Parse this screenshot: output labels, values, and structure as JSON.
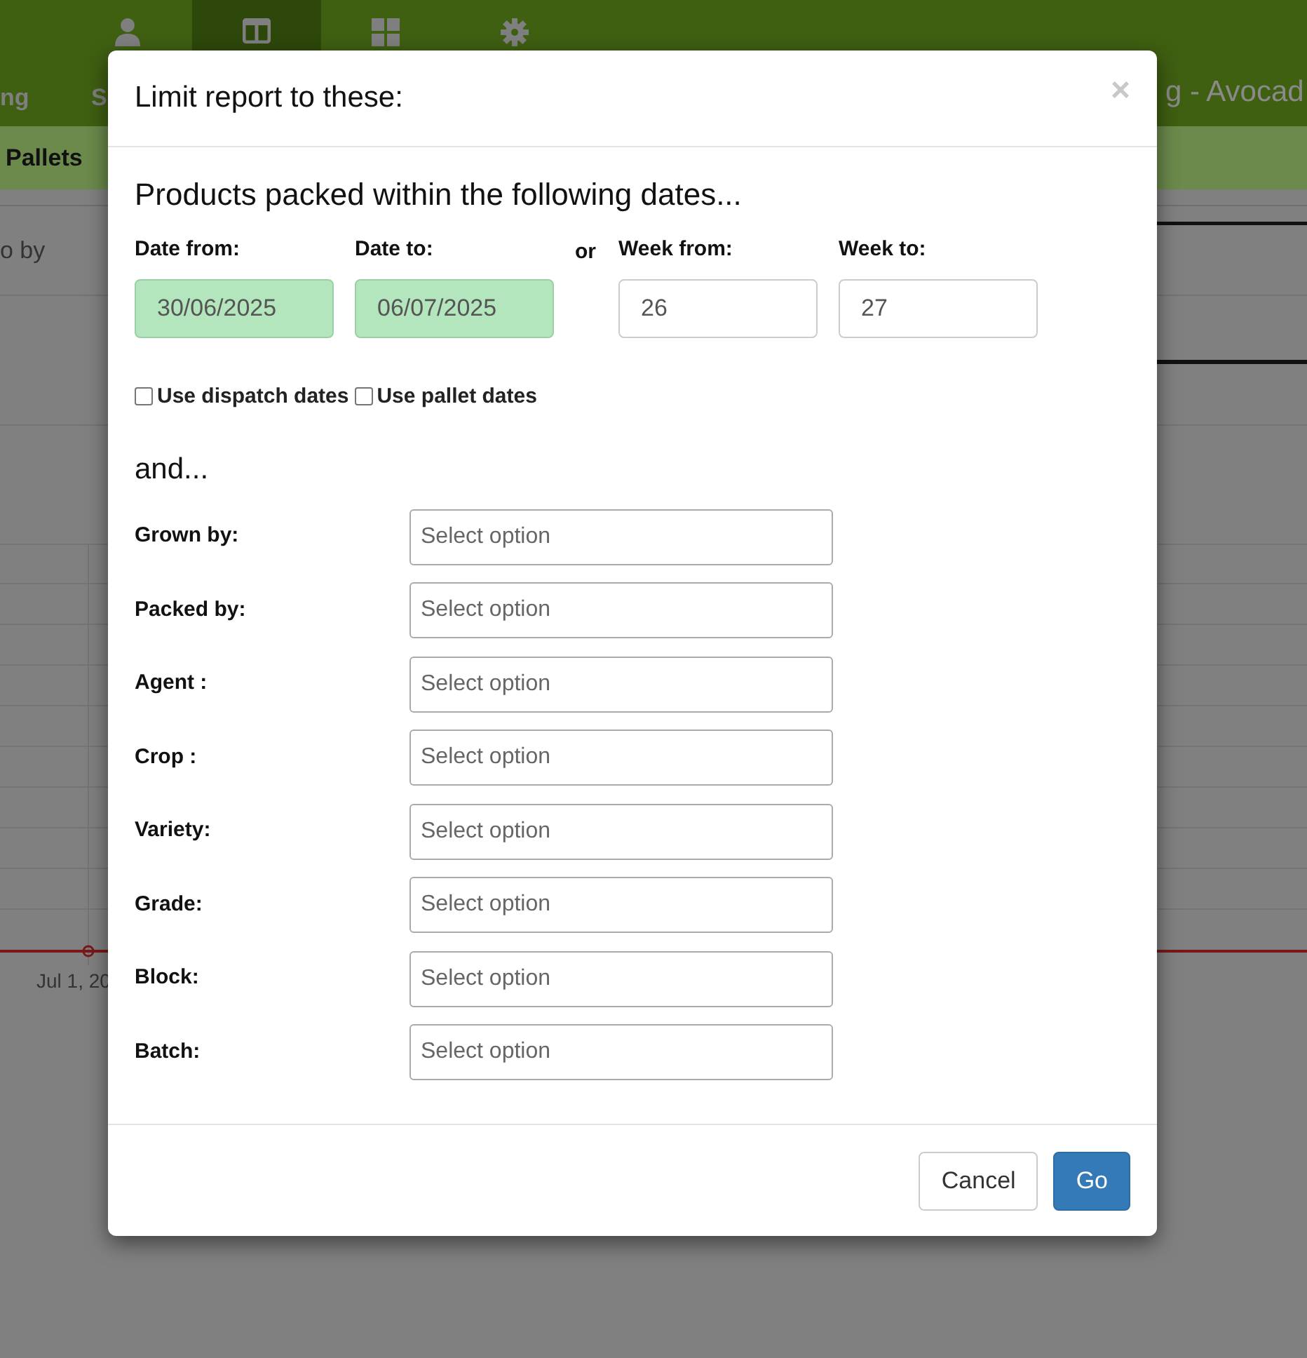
{
  "background": {
    "nav_items": [
      {
        "label": "ng",
        "selected": false
      },
      {
        "label": "S",
        "selected": false
      },
      {
        "selected": true
      },
      {
        "selected": false
      },
      {
        "selected": false
      }
    ],
    "app_title": "g - Avocad",
    "subnav": "Pallets",
    "group_label": "o by",
    "chart_label": "Jul 1, 20"
  },
  "modal": {
    "title": "Limit report to these:",
    "close": "×",
    "dates_heading": "Products packed within the following dates...",
    "date_fields": [
      {
        "label": "Date from:",
        "value": "30/06/2025",
        "highlighted": true
      },
      {
        "label": "Date to:",
        "value": "06/07/2025",
        "highlighted": true
      },
      {
        "label": "Week from:",
        "value": "26",
        "highlighted": false
      },
      {
        "label": "Week to:",
        "value": "27",
        "highlighted": false
      }
    ],
    "separator": "or",
    "checkboxes": [
      {
        "label": "Use dispatch dates",
        "checked": false
      },
      {
        "label": "Use pallet dates",
        "checked": false
      }
    ],
    "filters_heading": "and...",
    "filters": [
      {
        "label": "Grown by:",
        "placeholder": "Select option"
      },
      {
        "label": "Packed by:",
        "placeholder": "Select option"
      },
      {
        "label": "Agent :",
        "placeholder": "Select option"
      },
      {
        "label": "Crop :",
        "placeholder": "Select option"
      },
      {
        "label": "Variety:",
        "placeholder": "Select option"
      },
      {
        "label": "Grade:",
        "placeholder": "Select option"
      },
      {
        "label": "Block:",
        "placeholder": "Select option"
      },
      {
        "label": "Batch:",
        "placeholder": "Select option"
      }
    ],
    "buttons": [
      {
        "label": "Cancel",
        "kind": "default"
      },
      {
        "label": "Go",
        "kind": "primary"
      }
    ]
  }
}
